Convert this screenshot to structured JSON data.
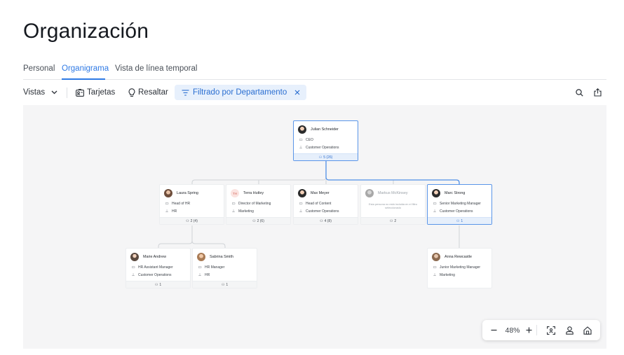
{
  "page": {
    "title": "Organización"
  },
  "tabs": [
    {
      "label": "Personal",
      "active": false
    },
    {
      "label": "Organigrama",
      "active": true
    },
    {
      "label": "Vista de línea temporal",
      "active": false
    }
  ],
  "toolbar": {
    "views_label": "Vistas",
    "cards_label": "Tarjetas",
    "highlight_label": "Resaltar",
    "filter_label": "Filtrado por Departamento",
    "accent_color": "#2f7ae5"
  },
  "org": {
    "julian": {
      "name": "Julian Schneider",
      "title": "CEO",
      "department": "Customer Operations",
      "reports": "5 (26)"
    },
    "laura": {
      "name": "Laura Spring",
      "title": "Head of HR",
      "department": "HR",
      "reports": "2 (4)"
    },
    "terra": {
      "name": "Terra Hutley",
      "initials": "TH",
      "title": "Director of Marketing",
      "department": "Marketing",
      "reports": "2 (6)"
    },
    "max": {
      "name": "Max Meyer",
      "title": "Head of Content",
      "department": "Customer Operations",
      "reports": "4 (8)"
    },
    "markus": {
      "name": "Markus McKinsey",
      "note": "Esta persona no está incluida en el filtro seleccionado",
      "reports": "2"
    },
    "marc": {
      "name": "Marc Strong",
      "title": "Senior Marketing Manager",
      "department": "Customer Operations",
      "reports": "1"
    },
    "marie": {
      "name": "Marie Andrew",
      "title": "HR Assistant Manager",
      "department": "Customer Operations",
      "reports": "1"
    },
    "sabrina": {
      "name": "Sabrina Smith",
      "title": "HR Manager",
      "department": "HR",
      "reports": "1"
    },
    "anna": {
      "name": "Anna Rewcastle",
      "title": "Junior Marketing Manager",
      "department": "Marketing"
    }
  },
  "zoom": {
    "level": "48%"
  }
}
